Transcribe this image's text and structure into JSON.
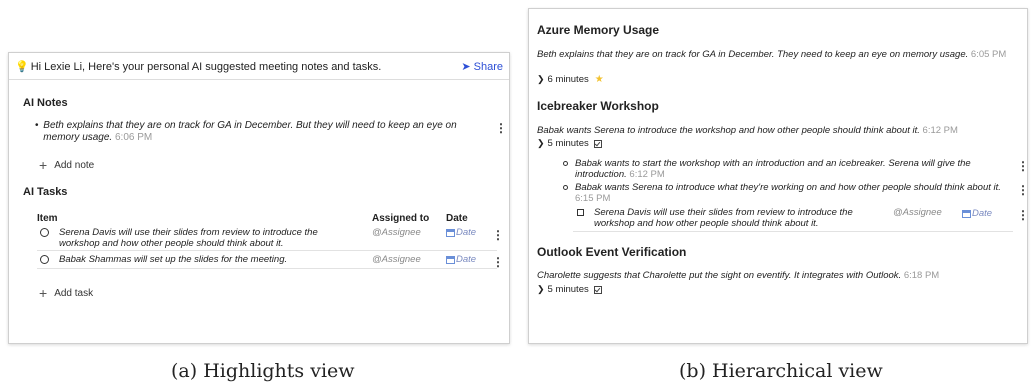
{
  "highlights": {
    "banner_text": "Hi Lexie Li, Here's your personal AI suggested meeting notes and tasks.",
    "share_label": "Share",
    "notes_title": "AI Notes",
    "notes": [
      {
        "text": "Beth explains that they are on track for GA in December. But they will need to keep an eye on memory usage.",
        "time": "6:06 PM"
      }
    ],
    "add_note_label": "Add note",
    "tasks_title": "AI Tasks",
    "columns": {
      "item": "Item",
      "assigned": "Assigned to",
      "date": "Date"
    },
    "tasks": [
      {
        "text": "Serena Davis will use their slides from review to introduce the workshop and how other people should think about it.",
        "assignee": "@Assignee",
        "date": "Date"
      },
      {
        "text": "Babak Shammas will set up the slides for the meeting.",
        "assignee": "@Assignee",
        "date": "Date"
      }
    ],
    "add_task_label": "Add task",
    "caption": "(a) Highlights view"
  },
  "hierarchical": {
    "sections": [
      {
        "title": "Azure Memory Usage",
        "summary": "Beth explains that they are on track for GA in December. They need to keep an eye on memory usage.",
        "time": "6:05 PM",
        "duration": "6 minutes"
      },
      {
        "title": "Icebreaker Workshop",
        "summary": "Babak wants Serena to introduce the workshop and how other people should think about it.",
        "time": "6:12 PM",
        "duration": "5 minutes",
        "subitems": [
          {
            "text": "Babak wants to start the workshop with an introduction and an icebreaker. Serena will give the introduction.",
            "time": "6:12 PM"
          },
          {
            "text": "Babak wants Serena to introduce what they're working on and how other people should think about it.",
            "time": "6:15 PM"
          }
        ],
        "task": {
          "text": "Serena Davis will use their slides from review to introduce the workshop and how other people should think about it.",
          "assignee": "@Assignee",
          "date": "Date"
        }
      },
      {
        "title": "Outlook Event Verification",
        "summary": "Charolette suggests that Charolette put the sight on eventify. It integrates with Outlook.",
        "time": "6:18 PM",
        "duration": "5 minutes"
      }
    ],
    "caption": "(b) Hierarchical view"
  },
  "colors": {
    "share": "#2d4fd6",
    "timestamp": "#9a9a9a",
    "star": "#f2c230",
    "bulb": "#f0b400"
  }
}
